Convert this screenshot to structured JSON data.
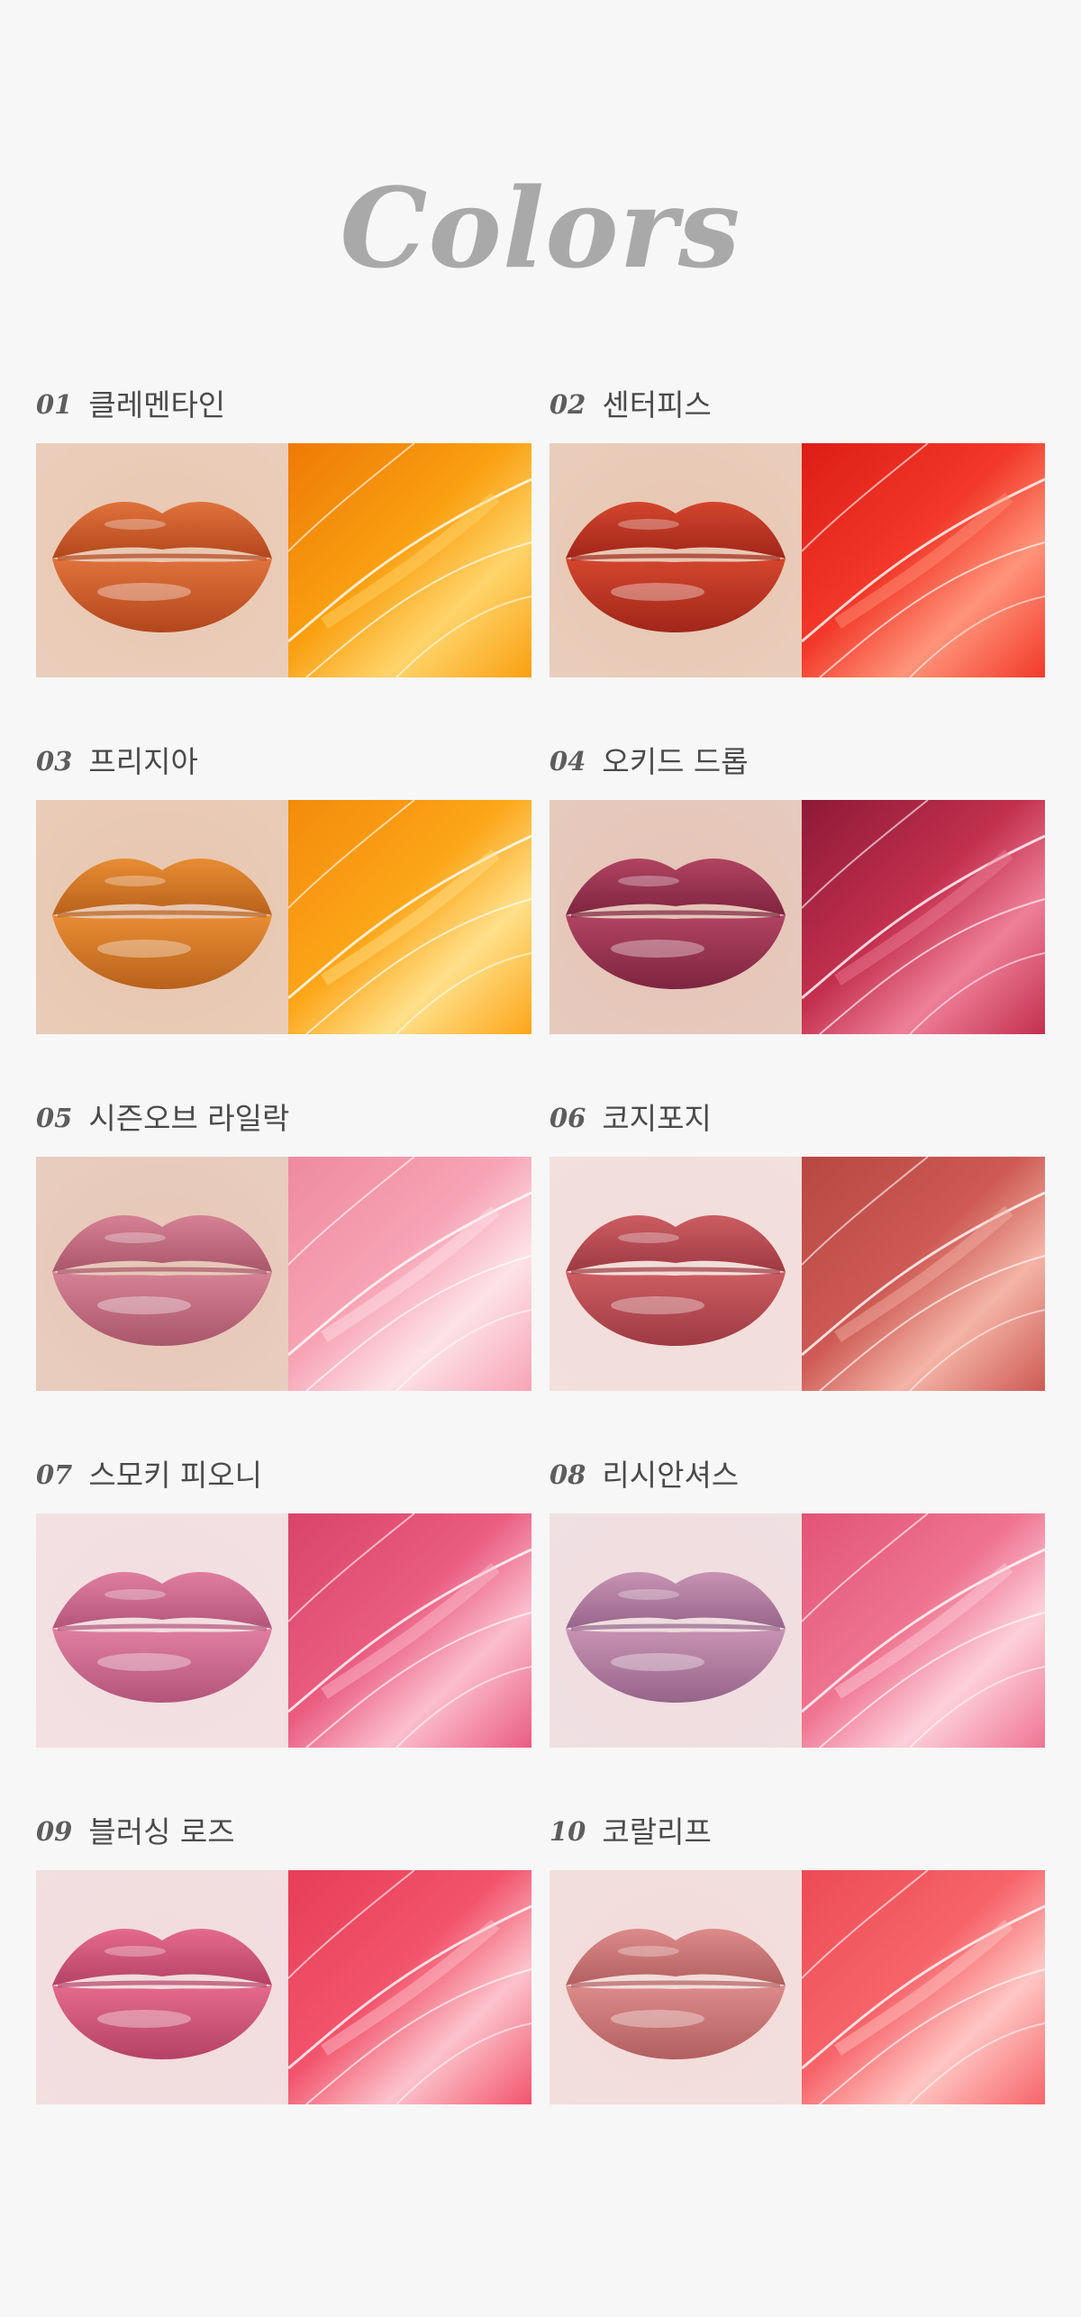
{
  "page": {
    "title": "Colors"
  },
  "shades": [
    {
      "num": "01",
      "name": "클레멘타인",
      "lip_color": "#e0723c",
      "lip_shadow": "#b2471c",
      "skin": "#e8c7b1",
      "texture_color": "#f9a011",
      "texture_dark": "#ee7a06",
      "texture_light": "#ffd46a"
    },
    {
      "num": "02",
      "name": "센터피스",
      "lip_color": "#d4462d",
      "lip_shadow": "#a0261a",
      "skin": "#e7c6b1",
      "texture_color": "#f2392a",
      "texture_dark": "#dd1d16",
      "texture_light": "#ff9479"
    },
    {
      "num": "03",
      "name": "프리지아",
      "lip_color": "#e88d33",
      "lip_shadow": "#b8611c",
      "skin": "#e7c5ae",
      "texture_color": "#fca619",
      "texture_dark": "#f38b0b",
      "texture_light": "#ffe08a"
    },
    {
      "num": "04",
      "name": "오키드 드롭",
      "lip_color": "#b04462",
      "lip_shadow": "#7e2440",
      "skin": "#e4c3b5",
      "texture_color": "#c3304f",
      "texture_dark": "#8d1a36",
      "texture_light": "#ee7f97"
    },
    {
      "num": "05",
      "name": "시즌오브 라일락",
      "lip_color": "#d58293",
      "lip_shadow": "#a9566b",
      "skin": "#e6c6b6",
      "texture_color": "#f7a4b5",
      "texture_dark": "#ef8aa0",
      "texture_light": "#fde2e8"
    },
    {
      "num": "06",
      "name": "코지포지",
      "lip_color": "#cc5d62",
      "lip_shadow": "#9e3a42",
      "skin": "#f1dcd8",
      "texture_color": "#cd5a54",
      "texture_dark": "#b84742",
      "texture_light": "#f4b4a6"
    },
    {
      "num": "07",
      "name": "스모키 피오니",
      "lip_color": "#e07ea0",
      "lip_shadow": "#b3557a",
      "skin": "#f2dde0",
      "texture_color": "#ea5c80",
      "texture_dark": "#d9446a",
      "texture_light": "#fbbecd"
    },
    {
      "num": "08",
      "name": "리시안셔스",
      "lip_color": "#c893b3",
      "lip_shadow": "#96658a",
      "skin": "#efdcdf",
      "texture_color": "#ef7491",
      "texture_dark": "#e15477",
      "texture_light": "#fdd0db"
    },
    {
      "num": "09",
      "name": "블러싱 로즈",
      "lip_color": "#e46a8d",
      "lip_shadow": "#b54266",
      "skin": "#f1dbdd",
      "texture_color": "#f2546c",
      "texture_dark": "#e73d58",
      "texture_light": "#fcc3cc"
    },
    {
      "num": "10",
      "name": "코랄리프",
      "lip_color": "#dd8b8a",
      "lip_shadow": "#b2605f",
      "skin": "#f1dbd8",
      "texture_color": "#f6646a",
      "texture_dark": "#ec4b55",
      "texture_light": "#ffc6c3"
    }
  ]
}
